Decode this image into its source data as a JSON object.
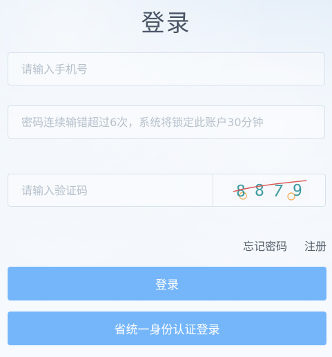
{
  "page": {
    "title": "登录"
  },
  "form": {
    "phone_placeholder": "请输入手机号",
    "password_placeholder": "密码连续输错超过6次，系统将锁定此账户30分钟",
    "captcha_placeholder": "请输入验证码"
  },
  "captcha": {
    "code": "8879",
    "chars": [
      "8",
      "8",
      "7",
      "9"
    ],
    "colors": [
      "#3c9aa0",
      "#3c9aa0",
      "#3c9aa0",
      "#3c9aa0"
    ],
    "strike_color": "#d9534f",
    "noise_circle_color": "#f0a850"
  },
  "links": {
    "forgot_password": "忘记密码",
    "register": "注册"
  },
  "buttons": {
    "login": "登录",
    "unified_login": "省统一身份认证登录"
  },
  "colors": {
    "primary_button": "#75b6fb",
    "border": "#d7e1ec",
    "placeholder": "#b7c1cc"
  }
}
